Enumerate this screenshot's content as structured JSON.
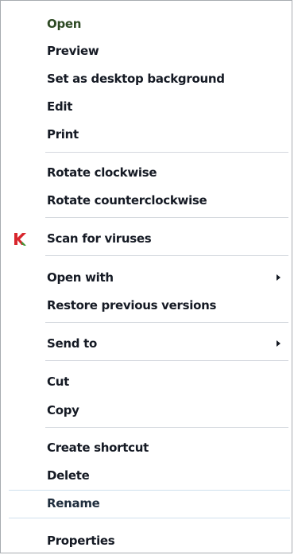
{
  "menu": {
    "open": "Open",
    "preview": "Preview",
    "set_background": "Set as desktop background",
    "edit": "Edit",
    "print": "Print",
    "rotate_cw": "Rotate clockwise",
    "rotate_ccw": "Rotate counterclockwise",
    "scan": "Scan for viruses",
    "open_with": "Open with",
    "restore": "Restore previous versions",
    "send_to": "Send to",
    "cut": "Cut",
    "copy": "Copy",
    "create_shortcut": "Create shortcut",
    "delete": "Delete",
    "rename": "Rename",
    "properties": "Properties"
  },
  "icons": {
    "scan_icon": "kaspersky-k-icon",
    "submenu_icon": "chevron-right-icon"
  },
  "colors": {
    "text": "#151a24",
    "separator": "#d4d8de",
    "accent_k_red": "#d8262d",
    "accent_k_green": "#3c9b3b"
  }
}
